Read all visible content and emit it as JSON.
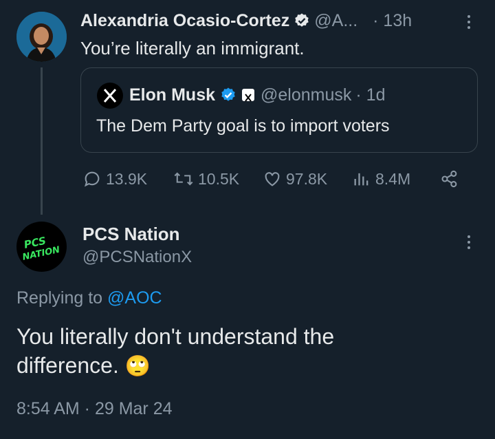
{
  "tweet1": {
    "author_name": "Alexandria Ocasio-Cortez",
    "handle": "@A...",
    "time": "· 13h",
    "text": "You’re literally an immigrant."
  },
  "quote": {
    "author_name": "Elon Musk",
    "handle": "@elonmusk",
    "time": "· 1d",
    "text": "The Dem Party goal is to import voters"
  },
  "actions": {
    "replies": "13.9K",
    "retweets": "10.5K",
    "likes": "97.8K",
    "views": "8.4M"
  },
  "tweet2": {
    "author_name": "PCS Nation",
    "handle": "@PCSNationX",
    "avatar_text_line1": "PCS",
    "avatar_text_line2": "NATION",
    "replying_prefix": "Replying to",
    "replying_handle": "@AOC",
    "text": "You literally don't understand the difference.",
    "emoji": "🙄",
    "timestamp": "8:54 AM · 29 Mar 24"
  },
  "colors": {
    "background": "#15202b",
    "text": "#e7e9ea",
    "muted": "#8b98a5",
    "accent": "#1d9bf0",
    "border": "#38444d",
    "pcs_green": "#39e75f"
  },
  "icons": [
    "verified-badge-icon",
    "x-logo-icon",
    "reply-icon",
    "retweet-icon",
    "like-icon",
    "views-icon",
    "share-icon",
    "more-icon"
  ]
}
